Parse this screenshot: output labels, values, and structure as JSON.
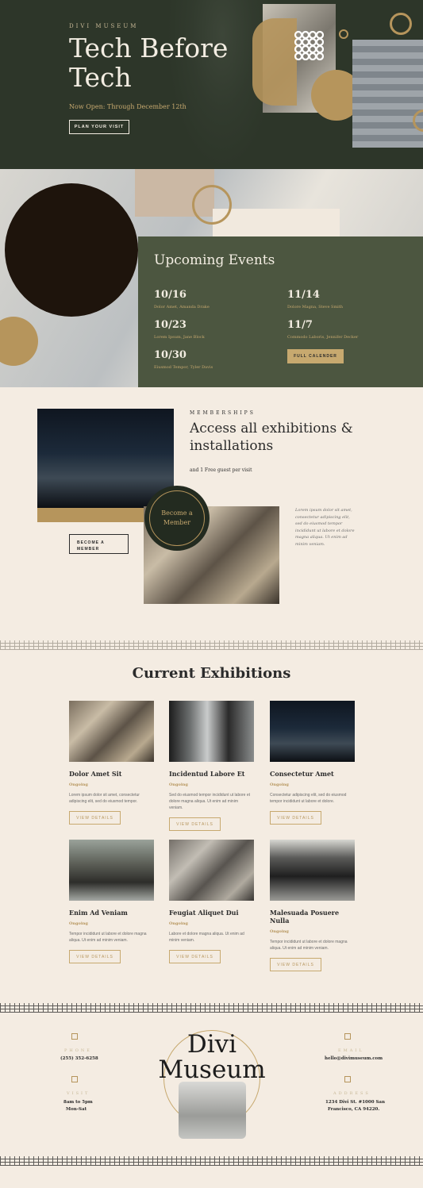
{
  "hero": {
    "eyebrow": "DIVI MUSEUM",
    "title": "Tech Before Tech",
    "subtitle": "Now Open: Through December 12th",
    "button": "PLAN YOUR VISIT"
  },
  "events": {
    "heading": "Upcoming Events",
    "items": [
      {
        "date": "10/16",
        "names": "Dolor Amet, Amanda Drake"
      },
      {
        "date": "10/23",
        "names": "Lorem Ipsum, Jane Block"
      },
      {
        "date": "10/30",
        "names": "Eiusmod Tempor, Tyler Davis"
      },
      {
        "date": "11/14",
        "names": "Dolore Magna, Steve Smith"
      },
      {
        "date": "11/7",
        "names": "Commodo Laboris, Jennifer Decker"
      }
    ],
    "button": "FULL CALENDER"
  },
  "memberships": {
    "eyebrow": "MEMBERSHIPS",
    "heading": "Access all exhibitions & installations",
    "subline": "and 1 Free guest per visit",
    "badge": "Become a Member",
    "button": "BECOME A MEMBER",
    "body": "Lorem ipsum dolor sit amet, consectetur adipiscing elit, sed do eiusmod tempor incididunt ut labore et dolore magna aliqua. Ut enim ad minim veniam."
  },
  "exhibitions": {
    "heading": "Current Exhibitions",
    "cards": [
      {
        "title": "Dolor Amet Sit",
        "status": "Ongoing",
        "desc": "Lorem ipsum dolor sit amet, consectetur adipiscing elit, sed do eiusmod tempor.",
        "button": "VIEW DETAILS"
      },
      {
        "title": "Incidentud Labore Et",
        "status": "Ongoing",
        "desc": "Sed do eiusmod tempor incididunt ut labore et dolore magna aliqua. Ut enim ad minim veniam.",
        "button": "VIEW DETAILS"
      },
      {
        "title": "Consectetur Amet",
        "status": "Ongoing",
        "desc": "Consectetur adipiscing elit, sed do eiusmod tempor incididunt ut labore et dolore.",
        "button": "VIEW DETAILS"
      },
      {
        "title": "Enim Ad Veniam",
        "status": "Ongoing",
        "desc": "Tempor incididunt ut labore et dolore magna aliqua. Ut enim ad minim veniam.",
        "button": "VIEW DETAILS"
      },
      {
        "title": "Feugiat Aliquet Dui",
        "status": "Ongoing",
        "desc": "Labore et dolore magna aliqua. Ut enim ad minim veniam.",
        "button": "VIEW DETAILS"
      },
      {
        "title": "Malesuada Posuere Nulla",
        "status": "Ongoing",
        "desc": "Tempor incididunt ut labore et dolore magna aliqua. Ut enim ad minim veniam.",
        "button": "VIEW DETAILS"
      }
    ]
  },
  "footer": {
    "logo": "Divi Museum",
    "phone_label": "PHONE",
    "phone": "(255) 352-6258",
    "visit_label": "VISIT",
    "hours_1": "8am to 5pm",
    "hours_2": "Mon-Sat",
    "email_label": "EMAIL",
    "email": "hello@divimuseum.com",
    "address_label": "ADDRESS",
    "address_1": "1234 Divi St. #1000 San",
    "address_2": "Francisco, CA 94220."
  },
  "colors": {
    "dark_green": "#2d3629",
    "olive": "#4c5640",
    "gold": "#b6955c",
    "cream": "#f4ece2"
  }
}
